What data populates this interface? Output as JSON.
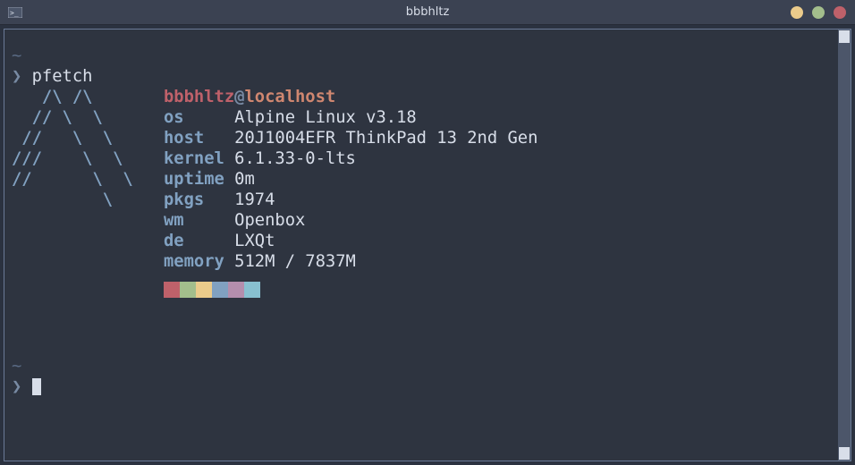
{
  "window": {
    "title": "bbbhltz"
  },
  "prompt": {
    "tilde": "~",
    "char": "❯",
    "command": "pfetch"
  },
  "ascii": [
    "   /\\ /\\",
    "  // \\  \\",
    " //   \\  \\",
    "///    \\  \\",
    "//      \\  \\",
    "         \\"
  ],
  "fetch": {
    "user": "bbbhltz",
    "at": "@",
    "hostname": "localhost",
    "labels": {
      "os": "os",
      "host": "host",
      "kernel": "kernel",
      "uptime": "uptime",
      "pkgs": "pkgs",
      "wm": "wm",
      "de": "de",
      "memory": "memory"
    },
    "values": {
      "os": "Alpine Linux v3.18",
      "host": "20J1004EFR ThinkPad 13 2nd Gen",
      "kernel": "6.1.33-0-lts",
      "uptime": "0m",
      "pkgs": "1974",
      "wm": "Openbox",
      "de": "LXQt",
      "memory": "512M / 7837M"
    }
  },
  "colors": [
    "#bf616a",
    "#a3be8c",
    "#ebcb8b",
    "#81a1c1",
    "#b48ead",
    "#88c0d0"
  ]
}
